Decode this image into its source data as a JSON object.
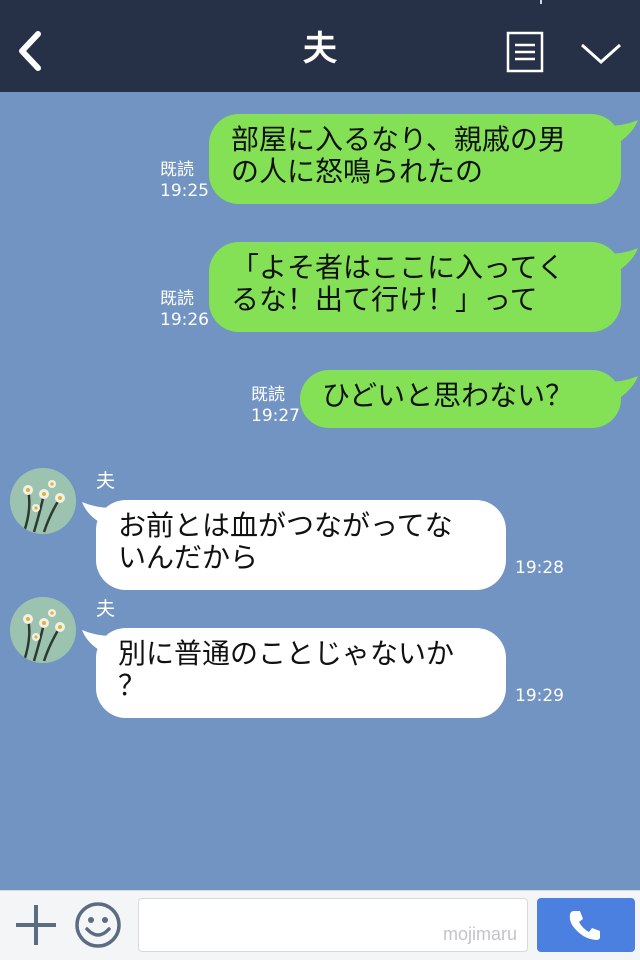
{
  "header": {
    "title": "夫"
  },
  "messages": [
    {
      "direction": "out",
      "read_label": "既読",
      "time": "19:25",
      "lines": [
        "部屋に入るなり、親戚の男",
        "の人に怒鳴られたの"
      ]
    },
    {
      "direction": "out",
      "read_label": "既読",
      "time": "19:26",
      "lines": [
        "「よそ者はここに入ってく",
        "るな！出て行け！」って"
      ]
    },
    {
      "direction": "out",
      "read_label": "既読",
      "time": "19:27",
      "lines": [
        "ひどいと思わない？"
      ]
    },
    {
      "direction": "in",
      "sender": "夫",
      "time": "19:28",
      "lines": [
        "お前とは血がつながってな",
        "いんだから"
      ]
    },
    {
      "direction": "in",
      "sender": "夫",
      "time": "19:29",
      "lines": [
        "別に普通のことじゃないか",
        "？"
      ]
    }
  ],
  "footer": {
    "input_value": "",
    "watermark": "mojimaru"
  },
  "colors": {
    "header_bg": "#263046",
    "chat_bg": "#7294c3",
    "outgoing_bubble": "#84e155",
    "incoming_bubble": "#ffffff",
    "call_button": "#4b7fe0"
  },
  "icons": {
    "back": "back-arrow-icon",
    "menu": "menu-list-icon",
    "expand": "chevron-down-icon",
    "add": "plus-icon",
    "emoji": "smile-icon",
    "call": "phone-icon"
  }
}
